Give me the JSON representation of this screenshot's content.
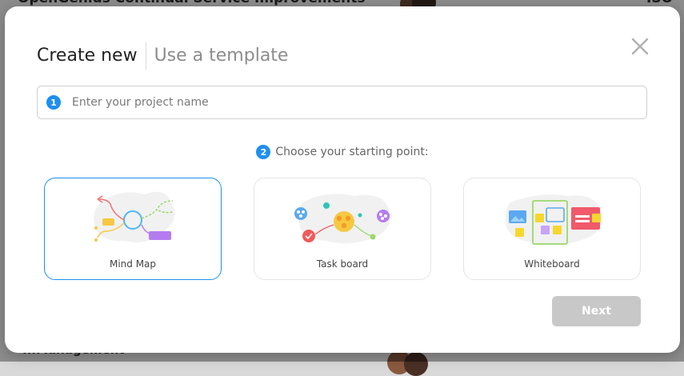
{
  "background": {
    "title": "OpenGenius Continual Service Improvements",
    "title_right": "ISO A",
    "bottom_text": "...Management"
  },
  "modal": {
    "tabs": [
      {
        "label": "Create new",
        "active": true
      },
      {
        "label": "Use a template",
        "active": false
      }
    ],
    "close_icon": "close-icon",
    "step1": {
      "badge": "1",
      "placeholder": "Enter your project name",
      "value": ""
    },
    "step2": {
      "badge": "2",
      "label": "Choose your starting point:"
    },
    "options": [
      {
        "label": "Mind Map",
        "selected": true,
        "icon": "mind-map-illustration"
      },
      {
        "label": "Task board",
        "selected": false,
        "icon": "task-board-illustration"
      },
      {
        "label": "Whiteboard",
        "selected": false,
        "icon": "whiteboard-illustration"
      }
    ],
    "next_label": "Next"
  },
  "colors": {
    "accent": "#1e8ff0",
    "disabled_button": "#c8c8c8"
  }
}
